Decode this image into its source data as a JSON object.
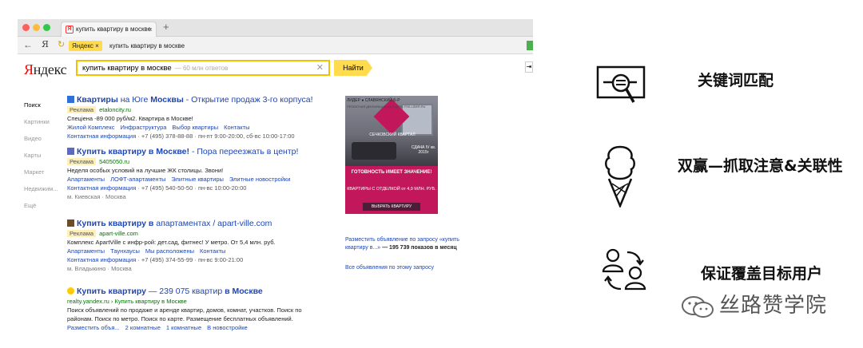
{
  "browser": {
    "tab_title": "купить квартиру в москве",
    "new_tab": "+",
    "nav_back": "←",
    "nav_ya": "Я",
    "address_pill": "Яндекс ×",
    "address_text": "купить квартиру в москве"
  },
  "yandex": {
    "logo_red": "Я",
    "logo_rest": "ндекс",
    "search_query": "купить квартиру в москве",
    "search_hint": "— 60 млн ответов",
    "clear": "✕",
    "find_button": "Найти",
    "sidenav": [
      "Поиск",
      "Картинки",
      "Видео",
      "Карты",
      "Маркет",
      "Недвижим...",
      "Ещё"
    ],
    "results": [
      {
        "title_bold": "Квартиры",
        "title_plain1": " на Юге ",
        "title_bold2": "Москвы",
        "title_plain2": " - Открытие продаж 3-го корпуса!",
        "badge": "Реклама",
        "url": "etalonсity.ru",
        "desc": "Спецiена -89 000 руб/м2. Квартира в Москве!",
        "links": [
          "Жилой Комплекс",
          "Инфраструктура",
          "Выбор квартиры",
          "Контакты"
        ],
        "contact": "Контактная информация",
        "contact_rest": " · +7 (495) 378-88-88 · пн-пт 9:00-20:00, сб-вс 10:00-17:00",
        "metro": ""
      },
      {
        "title_bold": "Купить квартиру в Москве!",
        "title_plain1": " - Пора переезжать в центр!",
        "title_bold2": "",
        "title_plain2": "",
        "badge": "Реклама",
        "url": "5405050.ru",
        "desc": "Неделя особых условий на лучшие ЖК столицы. Звони!",
        "links": [
          "Апартаменты",
          "ЛОФТ-апартаменты",
          "Элитные квартиры",
          "Элитные новостройки"
        ],
        "contact": "Контактная информация",
        "contact_rest": " · +7 (495) 540-50-50 · пн-вс 10:00-20:00",
        "metro": "м. Киевская · Москва"
      },
      {
        "title_bold": "Купить квартиру в",
        "title_plain1": " апартаментах / apart-ville.com",
        "title_bold2": "",
        "title_plain2": "",
        "badge": "Реклама",
        "url": "apart-ville.com",
        "desc": "Комплекс ApartVille с инфр-рой: дет.сад, фитнес! У метро. От 5,4 млн. руб.",
        "links": [
          "Апартаменты",
          "Таунхаусы",
          "Мы расположены",
          "Контакты"
        ],
        "contact": "Контактная информация",
        "contact_rest": " · +7 (495) 374-55-99 · пн-вс 9:00-21:00",
        "metro": "м. Владыкино · Москва"
      },
      {
        "title_bold": "Купить квартиру",
        "title_plain1": " — 239 075 квартир ",
        "title_bold2": "в Москве",
        "title_plain2": "",
        "badge": "",
        "url": "realty.yandex.ru › Купить квартиру в Москве",
        "desc": "Поиск объявлений по продаже и аренде квартир, домов, комнат, участков. Поиск по",
        "desc2": "районам. Поиск по метро. Поиск по карте. Размещение бесплатных объявлений.",
        "links": [
          "Разместить объя...",
          "2 комнатные",
          "1 комнатные",
          "В новостройке"
        ],
        "contact": "",
        "contact_rest": "",
        "metro": ""
      }
    ],
    "banner": {
      "logo_text": "СЕЧКОВСКИЙ КВАРТАЛ",
      "sdacha": "СДАЧА IV кв. 2015г",
      "headline": "ГОТОВНОСТЬ ИМЕЕТ ЗНАЧЕНИЕ!",
      "offer": "КВАРТИРЫ С ОТДЕЛКОЙ от 4,9 МЛН. РУБ.",
      "button": "ВЫБРАТЬ КВАРТИРУ",
      "footer": "ЛИДЕР  ● СЛАВЯНСКИЙ Б-Р",
      "footer_small": "ПРОЕКТНАЯ ДЕКЛАРАЦИЯ НА САЙТЕ: FSK-LIDER.RU"
    },
    "ad_caption_link": "Разместить объявление по запросу «купить квартиру в...»",
    "ad_caption_count": " — 195 739 показов в месяц",
    "all_ads": "Все объявления по этому запросу"
  },
  "features": [
    {
      "label": "关键词匹配",
      "icon": "keyword-search-icon"
    },
    {
      "label": "双赢—抓取注意&关联性",
      "icon": "ice-cream-icon"
    },
    {
      "label": "保证覆盖目标用户",
      "icon": "users-exchange-icon"
    }
  ],
  "watermark": "丝路赞学院",
  "colors": {
    "yandex_yellow": "#ffdb4d",
    "link_blue": "#1e46b4",
    "banner_pink": "#c2185b"
  }
}
